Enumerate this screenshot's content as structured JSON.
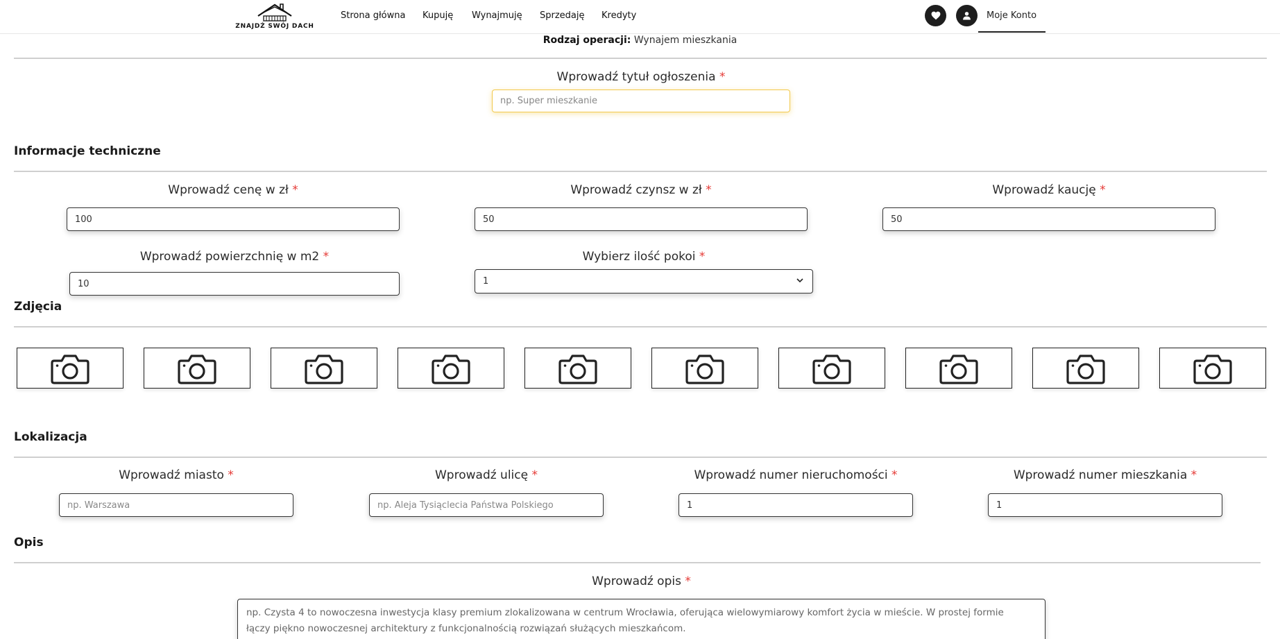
{
  "header": {
    "logo_text": "ZNAJDŹ SWÓJ DACH",
    "nav": [
      "Strona główna",
      "Kupuję",
      "Wynajmuję",
      "Sprzedaję",
      "Kredyty"
    ],
    "account_label": "Moje Konto"
  },
  "operation": {
    "label": "Rodzaj operacji:",
    "value": "Wynajem mieszkania"
  },
  "title_field": {
    "label": "Wprowadź tytuł ogłoszenia",
    "placeholder": "np. Super mieszkanie"
  },
  "technical": {
    "title": "Informacje techniczne",
    "price": {
      "label": "Wprowadź cenę w zł",
      "value": "100"
    },
    "rent": {
      "label": "Wprowadź czynsz w zł",
      "value": "50"
    },
    "deposit": {
      "label": "Wprowadź kaucję",
      "value": "50"
    },
    "area": {
      "label": "Wprowadź powierzchnię w m2",
      "value": "10"
    },
    "rooms": {
      "label": "Wybierz ilość pokoi",
      "value": "1"
    }
  },
  "photos": {
    "title": "Zdjęcia",
    "count": 10,
    "icon": "camera-icon"
  },
  "location": {
    "title": "Lokalizacja",
    "city": {
      "label": "Wprowadź miasto",
      "placeholder": "np. Warszawa"
    },
    "street": {
      "label": "Wprowadź ulicę",
      "placeholder": "np. Aleja Tysiąclecia Państwa Polskiego"
    },
    "property_number": {
      "label": "Wprowadź numer nieruchomości",
      "value": "1"
    },
    "apartment_number": {
      "label": "Wprowadź numer mieszkania",
      "value": "1"
    }
  },
  "description": {
    "title": "Opis",
    "label": "Wprowadź opis",
    "placeholder_line1": "np. Czysta 4 to nowoczesna inwestycja klasy premium zlokalizowana w centrum Wrocławia, oferująca wielowymiarowy komfort życia w mieście. W prostej formie",
    "placeholder_line2": "łączy piękno nowoczesnej architektury z funkcjonalnością rozwiązań służących mieszkańcom."
  },
  "required_mark": "*",
  "colors": {
    "required": "#e53935",
    "focus_border": "#f2c94c",
    "dark": "#1e1e1e"
  }
}
